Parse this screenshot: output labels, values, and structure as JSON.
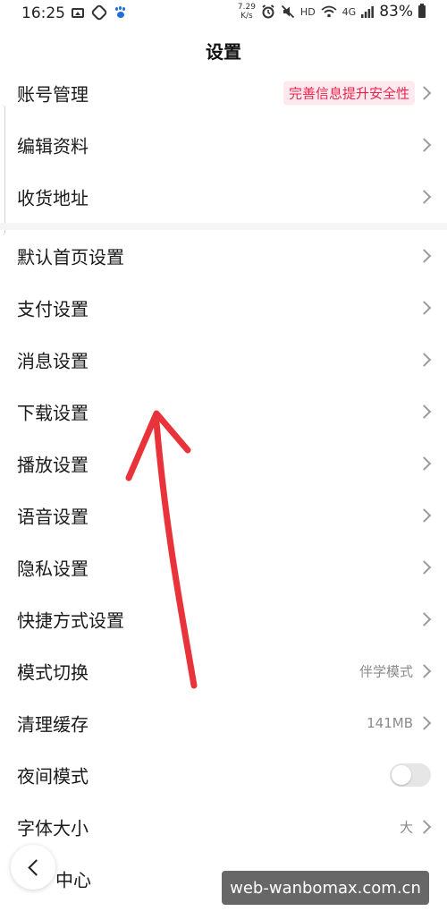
{
  "status_bar": {
    "time": "16:25",
    "speed_value": "7.29",
    "speed_unit": "K/s",
    "hd_label": "HD",
    "network_label": "4G",
    "battery": "83%"
  },
  "header": {
    "title": "设置"
  },
  "rows": [
    {
      "label": "账号管理",
      "badge": "完善信息提升安全性"
    },
    {
      "label": "编辑资料"
    },
    {
      "label": "收货地址"
    },
    {
      "label": "默认首页设置"
    },
    {
      "label": "支付设置"
    },
    {
      "label": "消息设置"
    },
    {
      "label": "下载设置"
    },
    {
      "label": "播放设置"
    },
    {
      "label": "语音设置"
    },
    {
      "label": "隐私设置"
    },
    {
      "label": "快捷方式设置"
    },
    {
      "label": "模式切换",
      "value": "伴学模式"
    },
    {
      "label": "清理缓存",
      "value": "141MB"
    },
    {
      "label": "夜间模式",
      "toggle_on": false
    },
    {
      "label": "字体大小",
      "value": "大"
    },
    {
      "label": "中心"
    }
  ],
  "colors": {
    "badge_text": "#e8254f",
    "badge_bg": "#fde9ee",
    "arrow": "#e8333a",
    "toggle_off": "#e6e6e6"
  },
  "watermark": "web-wanbomax.com.cn"
}
